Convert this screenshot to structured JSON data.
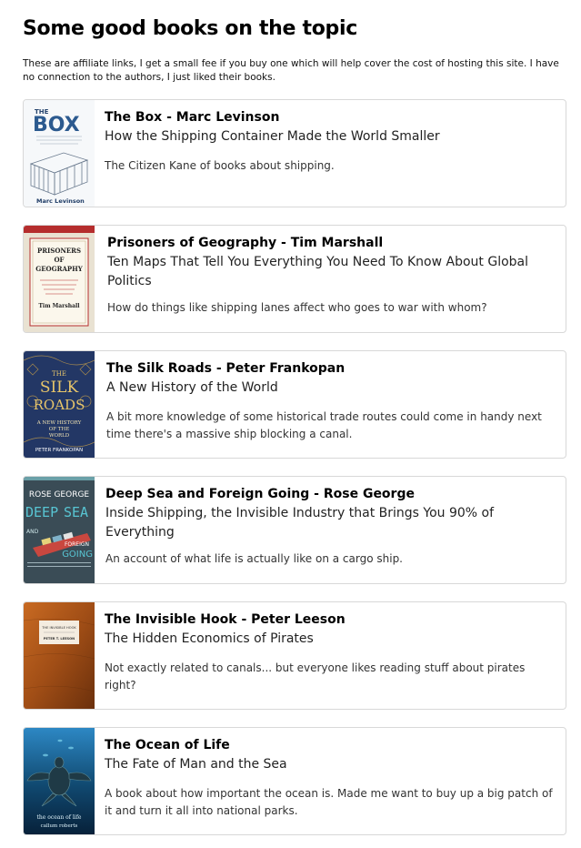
{
  "section": {
    "heading": "Some good books on the topic",
    "intro": "These are affiliate links, I get a small fee if you buy one which will help cover the cost of hosting this site. I have no connection to the authors, I just liked their books."
  },
  "books": [
    {
      "title": "The Box - Marc Levinson",
      "subtitle": "How the Shipping Container Made the World Smaller",
      "description": "The Citizen Kane of books about shipping.",
      "cover_text": [
        "THE",
        "BOX",
        "Marc Levinson"
      ]
    },
    {
      "title": "Prisoners of Geography - Tim Marshall",
      "subtitle": "Ten Maps That Tell You Everything You Need To Know About Global Politics",
      "description": "How do things like shipping lanes affect who goes to war with whom?",
      "cover_text": [
        "PRISONERS",
        "OF",
        "GEOGRAPHY",
        "Tim Marshall"
      ]
    },
    {
      "title": "The Silk Roads - Peter Frankopan",
      "subtitle": "A New History of the World",
      "description": "A bit more knowledge of some historical trade routes could come in handy next time there's a massive ship blocking a canal.",
      "cover_text": [
        "THE",
        "SILK",
        "ROADS",
        "A NEW HISTORY",
        "OF THE",
        "WORLD",
        "PETER FRANKOPAN"
      ]
    },
    {
      "title": "Deep Sea and Foreign Going - Rose George",
      "subtitle": "Inside Shipping, the Invisible Industry that Brings You 90% of Everything",
      "description": "An account of what life is actually like on a cargo ship.",
      "cover_text": [
        "ROSE GEORGE",
        "DEEP",
        "SEA",
        "AND",
        "FOREIGN",
        "GOING"
      ]
    },
    {
      "title": "The Invisible Hook - Peter Leeson",
      "subtitle": "The Hidden Economics of Pirates",
      "description": "Not exactly related to canals... but everyone likes reading stuff about pirates right?",
      "cover_text": [
        "THE INVISIBLE HOOK",
        "PETER T. LEESON"
      ]
    },
    {
      "title": "The Ocean of Life",
      "subtitle": "The Fate of Man and the Sea",
      "description": "A book about how important the ocean is. Made me want to buy up a big patch of it and turn it all into national parks.",
      "cover_text": [
        "the ocean of life",
        "callum roberts"
      ]
    }
  ]
}
